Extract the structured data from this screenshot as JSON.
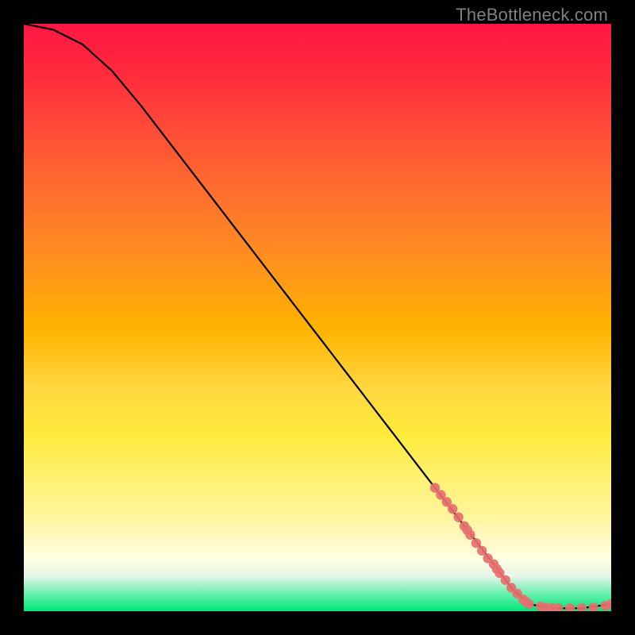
{
  "watermark": "TheBottleneck.com",
  "chart_data": {
    "type": "line",
    "title": "",
    "xlabel": "",
    "ylabel": "",
    "xlim": [
      0,
      100
    ],
    "ylim": [
      0,
      100
    ],
    "curve": {
      "x": [
        0,
        5,
        10,
        15,
        20,
        25,
        30,
        35,
        40,
        45,
        50,
        55,
        60,
        65,
        70,
        75,
        80,
        83,
        86,
        90,
        95,
        100
      ],
      "y": [
        100,
        99,
        96.5,
        92,
        86,
        79.5,
        73,
        66.5,
        60,
        53.5,
        47,
        40.5,
        34,
        27.5,
        21,
        14.5,
        8,
        4,
        1.2,
        0.5,
        0.5,
        1.2
      ]
    },
    "markers": {
      "x": [
        70,
        71,
        72,
        73,
        74,
        75,
        75.5,
        76,
        77,
        78,
        79,
        80,
        80.5,
        81,
        82,
        83,
        84,
        85,
        85.5,
        86,
        88,
        89,
        90,
        91,
        93,
        95,
        97,
        99,
        100
      ],
      "y": [
        21,
        19.8,
        18.6,
        17.4,
        16,
        14.5,
        13.8,
        13,
        11.6,
        10.3,
        9,
        8,
        7.2,
        6.5,
        5.3,
        4,
        3,
        2,
        1.6,
        1.2,
        0.8,
        0.6,
        0.5,
        0.5,
        0.5,
        0.5,
        0.6,
        0.9,
        1.2
      ]
    }
  }
}
